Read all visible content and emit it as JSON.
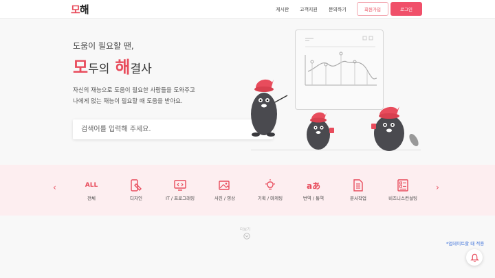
{
  "header": {
    "logo_part1": "모",
    "logo_part2": "해",
    "nav": [
      "게시판",
      "고객지원",
      "문의하기"
    ],
    "signup_label": "회원가입",
    "login_label": "로그인"
  },
  "hero": {
    "subtitle": "도움이 필요할 땐,",
    "title_mo": "모",
    "title_mid": "두의",
    "title_hae": "해",
    "title_end": "결사",
    "desc_line1": "자신의 재능으로 도움이 필요한 사람들을 도와주고",
    "desc_line2": "나에게 없는 재능이 필요할 때 도움을 받아요."
  },
  "search": {
    "placeholder": "검색어를 입력해 주세요."
  },
  "categories": [
    {
      "label": "전체",
      "icon": "all-text",
      "text": "ALL"
    },
    {
      "label": "디자인",
      "icon": "design-icon"
    },
    {
      "label": "IT / 프로그래밍",
      "icon": "programming-icon"
    },
    {
      "label": "사진 / 영상",
      "icon": "photo-icon"
    },
    {
      "label": "기획 / 마케팅",
      "icon": "lightbulb-icon"
    },
    {
      "label": "번역 / 통역",
      "icon": "translate-icon"
    },
    {
      "label": "문서작업",
      "icon": "document-icon"
    },
    {
      "label": "비즈니스컨설팅",
      "icon": "business-icon"
    }
  ],
  "more": {
    "label": "더보기"
  },
  "update_note": "*업데이트할 때 적용",
  "colors": {
    "accent": "#e84c5c",
    "band": "#fdeef0",
    "link": "#3a6fd8"
  }
}
